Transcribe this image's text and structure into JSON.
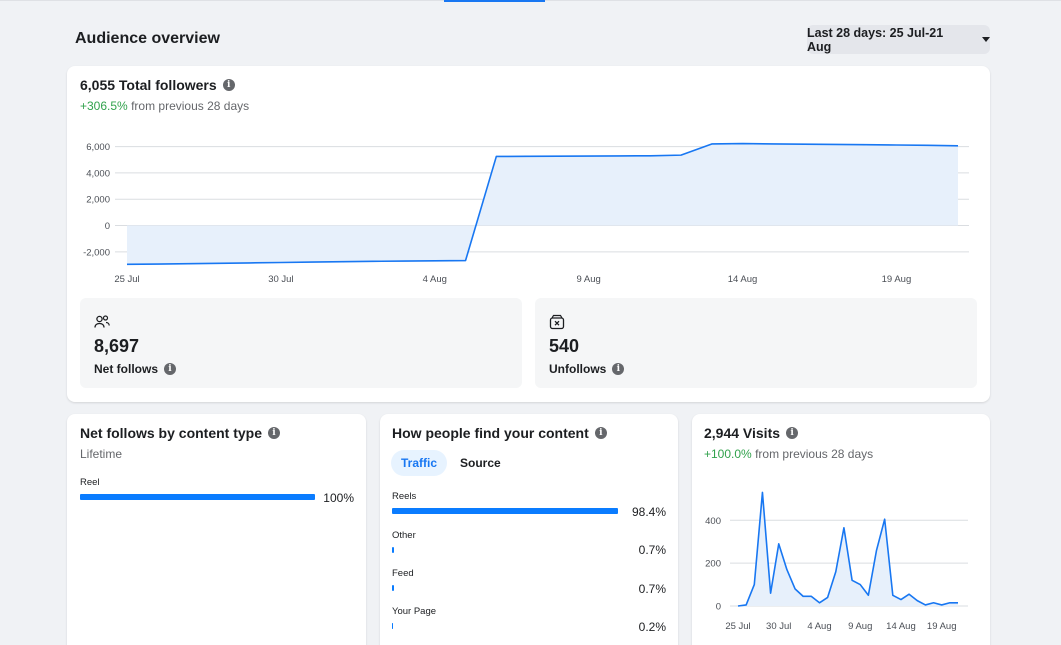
{
  "header": {
    "title": "Audience overview",
    "date_range": "Last 28 days: 25 Jul-21 Aug"
  },
  "followers": {
    "title": "6,055 Total followers",
    "delta_value": "+306.5%",
    "delta_text": "from previous 28 days",
    "net_follows_value": "8,697",
    "net_follows_label": "Net follows",
    "unfollows_value": "540",
    "unfollows_label": "Unfollows"
  },
  "content_type": {
    "title": "Net follows by content type",
    "subtitle": "Lifetime",
    "bars": [
      {
        "label": "Reel",
        "value": 100,
        "pct": "100%"
      }
    ]
  },
  "discovery": {
    "title": "How people find your content",
    "tabs": [
      "Traffic",
      "Source"
    ],
    "active_tab": "Traffic",
    "bars": [
      {
        "label": "Reels",
        "value": 98.4,
        "pct": "98.4%"
      },
      {
        "label": "Other",
        "value": 0.7,
        "pct": "0.7%"
      },
      {
        "label": "Feed",
        "value": 0.7,
        "pct": "0.7%"
      },
      {
        "label": "Your Page",
        "value": 0.2,
        "pct": "0.2%"
      }
    ]
  },
  "visits": {
    "title": "2,944 Visits",
    "delta_value": "+100.0%",
    "delta_text": "from previous 28 days"
  },
  "colors": {
    "accent": "#1877f2",
    "line": "#1877f2",
    "area": "#e7f0fb",
    "positive": "#31a24c",
    "bar": "#0a7cff"
  },
  "chart_data": [
    {
      "type": "area",
      "x": [
        "25 Jul",
        "26 Jul",
        "27 Jul",
        "28 Jul",
        "29 Jul",
        "30 Jul",
        "31 Jul",
        "1 Aug",
        "2 Aug",
        "3 Aug",
        "4 Aug",
        "5 Aug",
        "6 Aug",
        "7 Aug",
        "8 Aug",
        "9 Aug",
        "10 Aug",
        "11 Aug",
        "12 Aug",
        "13 Aug",
        "14 Aug",
        "15 Aug",
        "16 Aug",
        "17 Aug",
        "18 Aug",
        "19 Aug",
        "20 Aug",
        "21 Aug"
      ],
      "series": [
        {
          "values": [
            -2950,
            -2930,
            -2900,
            -2870,
            -2840,
            -2810,
            -2780,
            -2750,
            -2720,
            -2700,
            -2680,
            -2660,
            5250,
            5260,
            5270,
            5280,
            5290,
            5300,
            5350,
            6200,
            6230,
            6200,
            6180,
            6160,
            6140,
            6120,
            6100,
            6055
          ]
        }
      ],
      "x_ticks": [
        "25 Jul",
        "30 Jul",
        "4 Aug",
        "9 Aug",
        "14 Aug",
        "19 Aug"
      ],
      "y_ticks": [
        "6,000",
        "4,000",
        "2,000",
        "0",
        "-2,000"
      ],
      "ylim": [
        -3000,
        6500
      ],
      "grid": true
    },
    {
      "type": "area",
      "x": [
        "25 Jul",
        "26 Jul",
        "27 Jul",
        "28 Jul",
        "29 Jul",
        "30 Jul",
        "31 Jul",
        "1 Aug",
        "2 Aug",
        "3 Aug",
        "4 Aug",
        "5 Aug",
        "6 Aug",
        "7 Aug",
        "8 Aug",
        "9 Aug",
        "10 Aug",
        "11 Aug",
        "12 Aug",
        "13 Aug",
        "14 Aug",
        "15 Aug",
        "16 Aug",
        "17 Aug",
        "18 Aug",
        "19 Aug",
        "20 Aug",
        "21 Aug"
      ],
      "series": [
        {
          "values": [
            0,
            5,
            100,
            530,
            60,
            290,
            170,
            80,
            45,
            45,
            15,
            40,
            160,
            365,
            120,
            100,
            50,
            260,
            405,
            50,
            30,
            55,
            25,
            5,
            15,
            5,
            15,
            15
          ]
        }
      ],
      "x_ticks": [
        "25 Jul",
        "30 Jul",
        "4 Aug",
        "9 Aug",
        "14 Aug",
        "19 Aug"
      ],
      "y_ticks": [
        "400",
        "200",
        "0"
      ],
      "ylim": [
        0,
        560
      ],
      "grid": true
    }
  ]
}
